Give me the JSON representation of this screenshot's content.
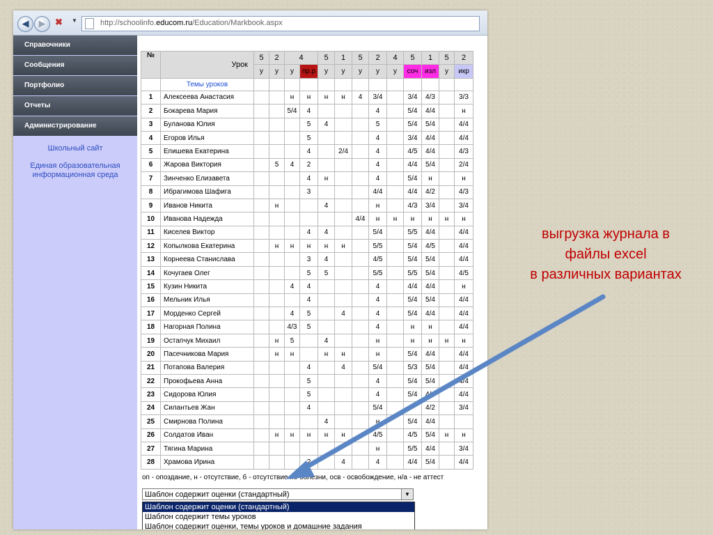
{
  "browser": {
    "url_prefix": "http://schoolinfo.",
    "url_domain": "educom.ru",
    "url_path": "/Education/Markbook.aspx"
  },
  "sidebar": {
    "items": [
      {
        "label": "Справочники"
      },
      {
        "label": "Сообщения"
      },
      {
        "label": "Портфолио"
      },
      {
        "label": "Отчеты"
      },
      {
        "label": "Администрирование"
      }
    ],
    "links": [
      {
        "label": "Школьный сайт"
      },
      {
        "label": "Единая образовательная информационная среда"
      }
    ]
  },
  "table": {
    "num_header": "№",
    "lesson_header": "Урок",
    "topics_label": "Темы уроков",
    "hour_values": [
      "5",
      "2",
      "4",
      "5",
      "1",
      "5",
      "2",
      "4",
      "5",
      "1",
      "5",
      "2"
    ],
    "types": [
      {
        "t": "у"
      },
      {
        "t": "у"
      },
      {
        "t": "у"
      },
      {
        "t": "пр.р",
        "color": "#b81414"
      },
      {
        "t": "у"
      },
      {
        "t": "у"
      },
      {
        "t": "у"
      },
      {
        "t": "у"
      },
      {
        "t": "у"
      },
      {
        "t": "соч",
        "color": "#ff2ce6"
      },
      {
        "t": "изл",
        "color": "#ff2ce6"
      },
      {
        "t": "у"
      },
      {
        "t": "икр",
        "color": "#c8c8f8"
      }
    ],
    "rows": [
      {
        "n": "1",
        "name": "Алексеева Анастасия",
        "g": [
          "",
          "",
          "н",
          "н",
          "н",
          "н",
          "4",
          "3/4",
          "",
          "3/4",
          "4/3",
          "",
          "3/3"
        ]
      },
      {
        "n": "2",
        "name": "Бокарева Мария",
        "g": [
          "",
          "",
          "5/4",
          "4",
          "",
          "",
          "",
          "4",
          "",
          "5/4",
          "4/4",
          "",
          "н"
        ]
      },
      {
        "n": "3",
        "name": "Буланова Юлия",
        "g": [
          "",
          "",
          "",
          "5",
          "4",
          "",
          "",
          "5",
          "",
          "5/4",
          "5/4",
          "",
          "4/4"
        ]
      },
      {
        "n": "4",
        "name": "Егоров Илья",
        "g": [
          "",
          "",
          "",
          "5",
          "",
          "",
          "",
          "4",
          "",
          "3/4",
          "4/4",
          "",
          "4/4"
        ]
      },
      {
        "n": "5",
        "name": "Епишева Екатерина",
        "g": [
          "",
          "",
          "",
          "4",
          "",
          "2/4",
          "",
          "4",
          "",
          "4/5",
          "4/4",
          "",
          "4/3"
        ]
      },
      {
        "n": "6",
        "name": "Жарова Виктория",
        "g": [
          "",
          "5",
          "4",
          "2",
          "",
          "",
          "",
          "4",
          "",
          "4/4",
          "5/4",
          "",
          "2/4"
        ]
      },
      {
        "n": "7",
        "name": "Зинченко Елизавета",
        "g": [
          "",
          "",
          "",
          "4",
          "н",
          "",
          "",
          "4",
          "",
          "5/4",
          "н",
          "",
          "н"
        ]
      },
      {
        "n": "8",
        "name": "Ибрагимова Шафига",
        "g": [
          "",
          "",
          "",
          "3",
          "",
          "",
          "",
          "4/4",
          "",
          "4/4",
          "4/2",
          "",
          "4/3"
        ]
      },
      {
        "n": "9",
        "name": "Иванов Никита",
        "g": [
          "",
          "н",
          "",
          "",
          "4",
          "",
          "",
          "н",
          "",
          "4/3",
          "3/4",
          "",
          "3/4"
        ]
      },
      {
        "n": "10",
        "name": "Иванова Надежда",
        "g": [
          "",
          "",
          "",
          "",
          "",
          "",
          "4/4",
          "н",
          "н",
          "н",
          "н",
          "н",
          "н"
        ]
      },
      {
        "n": "11",
        "name": "Киселев Виктор",
        "g": [
          "",
          "",
          "",
          "4",
          "4",
          "",
          "",
          "5/4",
          "",
          "5/5",
          "4/4",
          "",
          "4/4"
        ]
      },
      {
        "n": "12",
        "name": "Копылкова Екатерина",
        "g": [
          "",
          "н",
          "н",
          "н",
          "н",
          "н",
          "",
          "5/5",
          "",
          "5/4",
          "4/5",
          "",
          "4/4"
        ]
      },
      {
        "n": "13",
        "name": "Корнеева Станислава",
        "g": [
          "",
          "",
          "",
          "3",
          "4",
          "",
          "",
          "4/5",
          "",
          "5/4",
          "5/4",
          "",
          "4/4"
        ]
      },
      {
        "n": "14",
        "name": "Кочугаев Олег",
        "g": [
          "",
          "",
          "",
          "5",
          "5",
          "",
          "",
          "5/5",
          "",
          "5/5",
          "5/4",
          "",
          "4/5"
        ]
      },
      {
        "n": "15",
        "name": "Кузин Никита",
        "g": [
          "",
          "",
          "4",
          "4",
          "",
          "",
          "",
          "4",
          "",
          "4/4",
          "4/4",
          "",
          "н"
        ]
      },
      {
        "n": "16",
        "name": "Мельник Илья",
        "g": [
          "",
          "",
          "",
          "4",
          "",
          "",
          "",
          "4",
          "",
          "5/4",
          "5/4",
          "",
          "4/4"
        ]
      },
      {
        "n": "17",
        "name": "Морденко Сергей",
        "g": [
          "",
          "",
          "4",
          "5",
          "",
          "4",
          "",
          "4",
          "",
          "5/4",
          "4/4",
          "",
          "4/4"
        ]
      },
      {
        "n": "18",
        "name": "Нагорная Полина",
        "g": [
          "",
          "",
          "4/3",
          "5",
          "",
          "",
          "",
          "4",
          "",
          "н",
          "н",
          "",
          "4/4"
        ]
      },
      {
        "n": "19",
        "name": "Остапчук Михаил",
        "g": [
          "",
          "н",
          "5",
          "",
          "4",
          "",
          "",
          "н",
          "",
          "н",
          "н",
          "н",
          "н"
        ]
      },
      {
        "n": "20",
        "name": "Пасечникова Мария",
        "g": [
          "",
          "н",
          "н",
          "",
          "н",
          "н",
          "",
          "н",
          "",
          "5/4",
          "4/4",
          "",
          "4/4"
        ]
      },
      {
        "n": "21",
        "name": "Потапова Валерия",
        "g": [
          "",
          "",
          "",
          "4",
          "",
          "4",
          "",
          "5/4",
          "",
          "5/3",
          "5/4",
          "",
          "4/4"
        ]
      },
      {
        "n": "22",
        "name": "Прокофьева Анна",
        "g": [
          "",
          "",
          "",
          "5",
          "",
          "",
          "",
          "4",
          "",
          "5/4",
          "5/4",
          "",
          "4/4"
        ]
      },
      {
        "n": "23",
        "name": "Сидорова Юлия",
        "g": [
          "",
          "",
          "",
          "5",
          "",
          "",
          "",
          "4",
          "",
          "5/4",
          "4/4",
          "",
          "4/4"
        ]
      },
      {
        "n": "24",
        "name": "Силантьев Жан",
        "g": [
          "",
          "",
          "",
          "4",
          "",
          "",
          "",
          "5/4",
          "",
          "",
          "4/2",
          "",
          "3/4"
        ]
      },
      {
        "n": "25",
        "name": "Смирнова Полина",
        "g": [
          "",
          "",
          "",
          "",
          "4",
          "",
          "",
          "н",
          "",
          "5/4",
          "4/4",
          "",
          ""
        ]
      },
      {
        "n": "26",
        "name": "Солдатов Иван",
        "g": [
          "",
          "н",
          "н",
          "н",
          "н",
          "н",
          "",
          "4/5",
          "",
          "4/5",
          "5/4",
          "н",
          "н"
        ]
      },
      {
        "n": "27",
        "name": "Тягина Марина",
        "g": [
          "",
          "",
          "",
          "",
          "",
          "",
          "",
          "н",
          "",
          "5/5",
          "4/4",
          "",
          "3/4"
        ]
      },
      {
        "n": "28",
        "name": "Храмова Ирина",
        "g": [
          "",
          "",
          "",
          "2",
          "",
          "4",
          "",
          "4",
          "",
          "4/4",
          "5/4",
          "",
          "4/4"
        ]
      }
    ]
  },
  "legend": "оп - опоздание, н - отсутствие, б - отсутствие по болезни, осв - освобождение, н/а - не аттест",
  "template_select": {
    "selected": "Шаблон содержит оценки (стандартный)",
    "options": [
      "Шаблон содержит оценки (стандартный)",
      "Шаблон содержит темы уроков",
      "Шаблон содержит оценки, темы уроков и домашние задания"
    ]
  },
  "annotation": {
    "line1": "выгрузка журнала в",
    "line2": "файлы excel",
    "line3": "в различных вариантах",
    "color": "#c00000"
  },
  "arrow_color": "#5b86c5"
}
